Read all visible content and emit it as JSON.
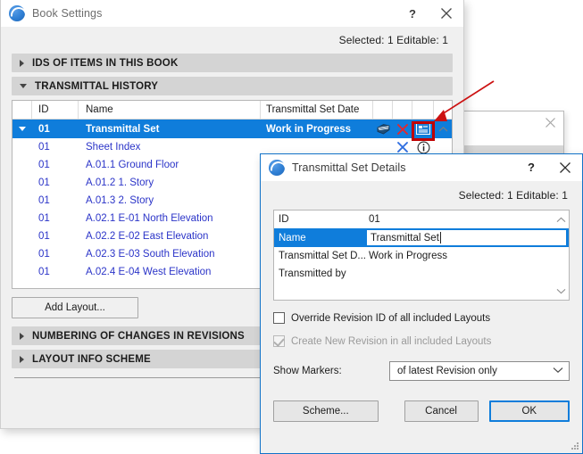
{
  "book_window": {
    "title": "Book Settings",
    "icon": "archicad-ball-icon",
    "help_label": "?",
    "close_label": "✕",
    "selection_info_prefix": "Selected: ",
    "selection_info": "Selected: 1 Editable: 1",
    "selected_count": "1",
    "editable_count": "1",
    "sections": [
      {
        "label": "IDS OF ITEMS IN THIS BOOK",
        "expanded": false
      },
      {
        "label": "TRANSMITTAL HISTORY",
        "expanded": true
      },
      {
        "label": "NUMBERING OF CHANGES IN REVISIONS",
        "expanded": false
      },
      {
        "label": "LAYOUT INFO SCHEME",
        "expanded": false
      }
    ],
    "table": {
      "columns": [
        "ID",
        "Name",
        "Transmittal Set Date"
      ],
      "rows": [
        {
          "id": "01",
          "name": "Transmittal Set",
          "date": "Work in Progress",
          "selected": true,
          "icons": [
            "layers-icon",
            "close-x-icon",
            "details-panel-icon",
            "chevron-up-icon"
          ]
        },
        {
          "id": "01",
          "name": "Sheet Index",
          "date": "",
          "selected": false,
          "icons": [
            "close-x-icon",
            "info-circle-icon"
          ]
        },
        {
          "id": "01",
          "name": "A.01.1 Ground Floor",
          "date": "",
          "selected": false,
          "icons": []
        },
        {
          "id": "01",
          "name": "A.01.2 1. Story",
          "date": "",
          "selected": false,
          "icons": []
        },
        {
          "id": "01",
          "name": "A.01.3 2. Story",
          "date": "",
          "selected": false,
          "icons": []
        },
        {
          "id": "01",
          "name": "A.02.1 E-01 North Elevation",
          "date": "",
          "selected": false,
          "icons": []
        },
        {
          "id": "01",
          "name": "A.02.2 E-02 East Elevation",
          "date": "",
          "selected": false,
          "icons": []
        },
        {
          "id": "01",
          "name": "A.02.3 E-03 South Elevation",
          "date": "",
          "selected": false,
          "icons": []
        },
        {
          "id": "01",
          "name": "A.02.4 E-04 West Elevation",
          "date": "",
          "selected": false,
          "icons": []
        }
      ]
    },
    "add_layout_label": "Add Layout..."
  },
  "background_window": {
    "close_label": "✕"
  },
  "details_dialog": {
    "title": "Transmittal Set Details",
    "icon": "archicad-ball-icon",
    "help_label": "?",
    "close_label": "✕",
    "selection_info": "Selected: 1 Editable: 1",
    "properties": [
      {
        "key": "ID",
        "value": "01",
        "selected": false,
        "editing": false
      },
      {
        "key": "Name",
        "value": "Transmittal Set",
        "selected": true,
        "editing": true
      },
      {
        "key": "Transmittal Set D...",
        "value": "Work in Progress",
        "selected": false,
        "editing": false
      },
      {
        "key": "Transmitted by",
        "value": "",
        "selected": false,
        "editing": false
      }
    ],
    "checkboxes": [
      {
        "label": "Override Revision ID of all included Layouts",
        "checked": false,
        "disabled": false
      },
      {
        "label": "Create New Revision in all included Layouts",
        "checked": true,
        "disabled": true
      }
    ],
    "show_markers": {
      "label": "Show Markers:",
      "value": "of latest Revision only",
      "options": [
        "of latest Revision only"
      ]
    },
    "buttons": {
      "scheme": "Scheme...",
      "cancel": "Cancel",
      "ok": "OK"
    }
  },
  "annotation": {
    "arrow_color": "#cc1111",
    "highlight_box_color": "#c00000",
    "target_icon": "details-panel-icon"
  },
  "colors": {
    "accent_blue": "#0f7ddb",
    "link_blue": "#2b34c8",
    "section_bar": "#d4d4d4",
    "window_bg": "#f0f0f0",
    "annotation_red": "#cc1111"
  }
}
